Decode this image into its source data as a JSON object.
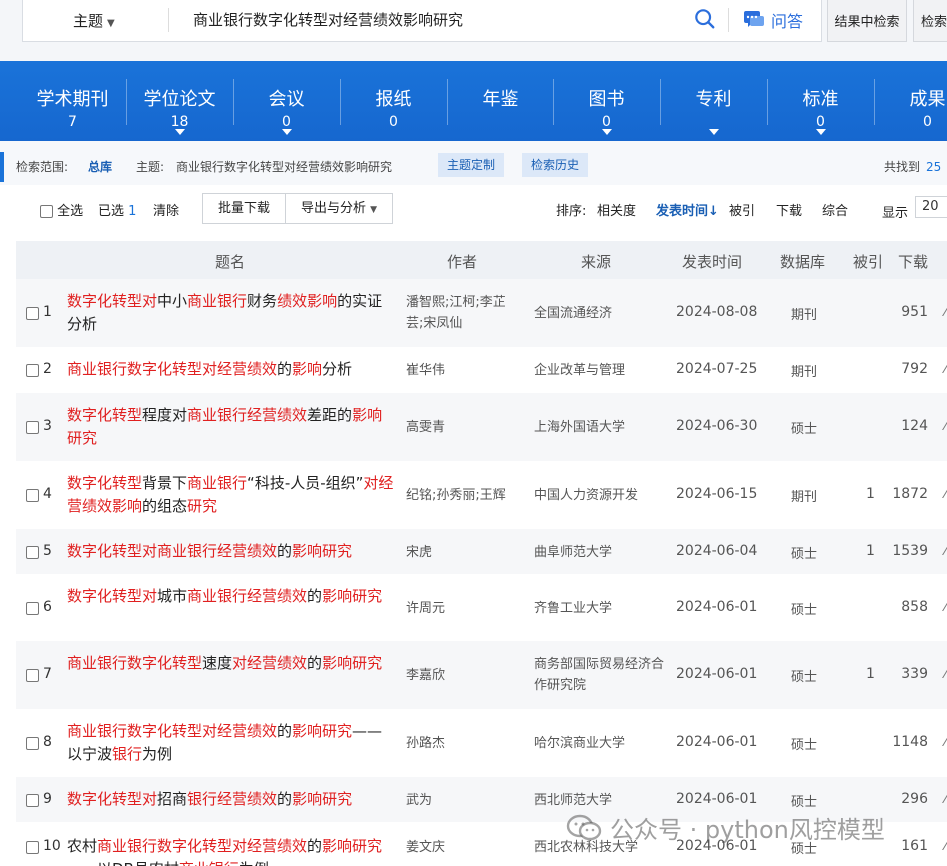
{
  "search": {
    "scope_label": "主题",
    "query": "商业银行数字化转型对经营绩效影响研究",
    "qa_label": "问答",
    "in_results_label": "结果中检索",
    "advanced_label": "检索"
  },
  "categories": [
    {
      "name": "学术期刊",
      "count": "7",
      "has_dropdown": false
    },
    {
      "name": "学位论文",
      "count": "18",
      "has_dropdown": true
    },
    {
      "name": "会议",
      "count": "0",
      "has_dropdown": true
    },
    {
      "name": "报纸",
      "count": "0",
      "has_dropdown": false
    },
    {
      "name": "年鉴",
      "count": "",
      "has_dropdown": false
    },
    {
      "name": "图书",
      "count": "0",
      "has_dropdown": true
    },
    {
      "name": "专利",
      "count": "",
      "has_dropdown": true
    },
    {
      "name": "标准",
      "count": "0",
      "has_dropdown": true
    },
    {
      "name": "成果",
      "count": "0",
      "has_dropdown": false
    }
  ],
  "scope_row": {
    "label": "检索范围:",
    "db_link": "总库",
    "topic_prefix": "主题:",
    "topic": "商业银行数字化转型对经营绩效影响研究",
    "btn_custom": "主题定制",
    "btn_history": "检索历史",
    "found_label": "共找到",
    "found_count": "25"
  },
  "toolbar": {
    "select_all": "全选",
    "selected_label": "已选",
    "selected_count": "1",
    "clear": "清除",
    "batch_download": "批量下载",
    "export": "导出与分析",
    "sort_label": "排序:",
    "sort_relevance": "相关度",
    "sort_date": "发表时间",
    "sort_cited": "被引",
    "sort_download": "下载",
    "sort_comprehensive": "综合",
    "show_label": "显示",
    "show_value": "20"
  },
  "table": {
    "headers": {
      "title": "题名",
      "author": "作者",
      "source": "来源",
      "date": "发表时间",
      "db": "数据库",
      "cite": "被引",
      "download": "下载"
    },
    "rows": [
      {
        "num": "1",
        "title_html": "<span class='hl'>数字化转型对</span>中小<span class='hl'>商业银行</span>财务<span class='hl'>绩效影响</span>的实证分析",
        "author": "潘智熙;江柯;李芷芸;宋凤仙",
        "source": "全国流通经济",
        "date": "2024-08-08",
        "db": "期刊",
        "cite": "",
        "download": "951"
      },
      {
        "num": "2",
        "title_html": "<span class='hl'>商业银行数字化转型对经营绩效</span>的<span class='hl'>影响</span>分析",
        "author": "崔华伟",
        "source": "企业改革与管理",
        "date": "2024-07-25",
        "db": "期刊",
        "cite": "",
        "download": "792"
      },
      {
        "num": "3",
        "title_html": "<span class='hl'>数字化转型</span>程度对<span class='hl'>商业银行经营绩效</span>差距的<span class='hl'>影响研究</span>",
        "author": "高雯青",
        "source": "上海外国语大学",
        "date": "2024-06-30",
        "db": "硕士",
        "cite": "",
        "download": "124"
      },
      {
        "num": "4",
        "title_html": "<span class='hl'>数字化转型</span>背景下<span class='hl'>商业银行</span>“科技-人员-组织”<span class='hl'>对经营绩效影响</span>的组态<span class='hl'>研究</span>",
        "author": "纪铭;孙秀丽;王辉",
        "source": "中国人力资源开发",
        "date": "2024-06-15",
        "db": "期刊",
        "cite": "1",
        "download": "1872"
      },
      {
        "num": "5",
        "title_html": "<span class='hl'>数字化转型对商业银行经营绩效</span>的<span class='hl'>影响研究</span>",
        "author": "宋虎",
        "source": "曲阜师范大学",
        "date": "2024-06-04",
        "db": "硕士",
        "cite": "1",
        "download": "1539"
      },
      {
        "num": "6",
        "title_html": "<span class='hl'>数字化转型对</span>城市<span class='hl'>商业银行经营绩效</span>的<span class='hl'>影响研究</span>",
        "author": "许周元",
        "source": "齐鲁工业大学",
        "date": "2024-06-01",
        "db": "硕士",
        "cite": "",
        "download": "858"
      },
      {
        "num": "7",
        "title_html": "<span class='hl'>商业银行数字化转型</span>速度<span class='hl'>对经营绩效</span>的<span class='hl'>影响研究</span>",
        "author": "李嘉欣",
        "source": "商务部国际贸易经济合作研究院",
        "date": "2024-06-01",
        "db": "硕士",
        "cite": "1",
        "download": "339"
      },
      {
        "num": "8",
        "title_html": "<span class='hl'>商业银行数字化转型对经营绩效</span>的<span class='hl'>影响研究</span>——以宁波<span class='hl'>银行</span>为例",
        "author": "孙路杰",
        "source": "哈尔滨商业大学",
        "date": "2024-06-01",
        "db": "硕士",
        "cite": "",
        "download": "1148"
      },
      {
        "num": "9",
        "title_html": "<span class='hl'>数字化转型对</span>招商<span class='hl'>银行经营绩效</span>的<span class='hl'>影响研究</span>",
        "author": "武为",
        "source": "西北师范大学",
        "date": "2024-06-01",
        "db": "硕士",
        "cite": "",
        "download": "296"
      },
      {
        "num": "10",
        "title_html": "农村<span class='hl'>商业银行数字化转型对经营绩效</span>的<span class='hl'>影响研究</span>——以DB县农村<span class='hl'>商业银行</span>为例",
        "author": "姜文庆",
        "source": "西北农林科技大学",
        "date": "2024-06-01",
        "db": "硕士",
        "cite": "",
        "download": "161"
      }
    ]
  },
  "watermark": "公众号 · python风控模型",
  "colors": {
    "brand_blue": "#1a73d9",
    "highlight_red": "#e02020"
  }
}
